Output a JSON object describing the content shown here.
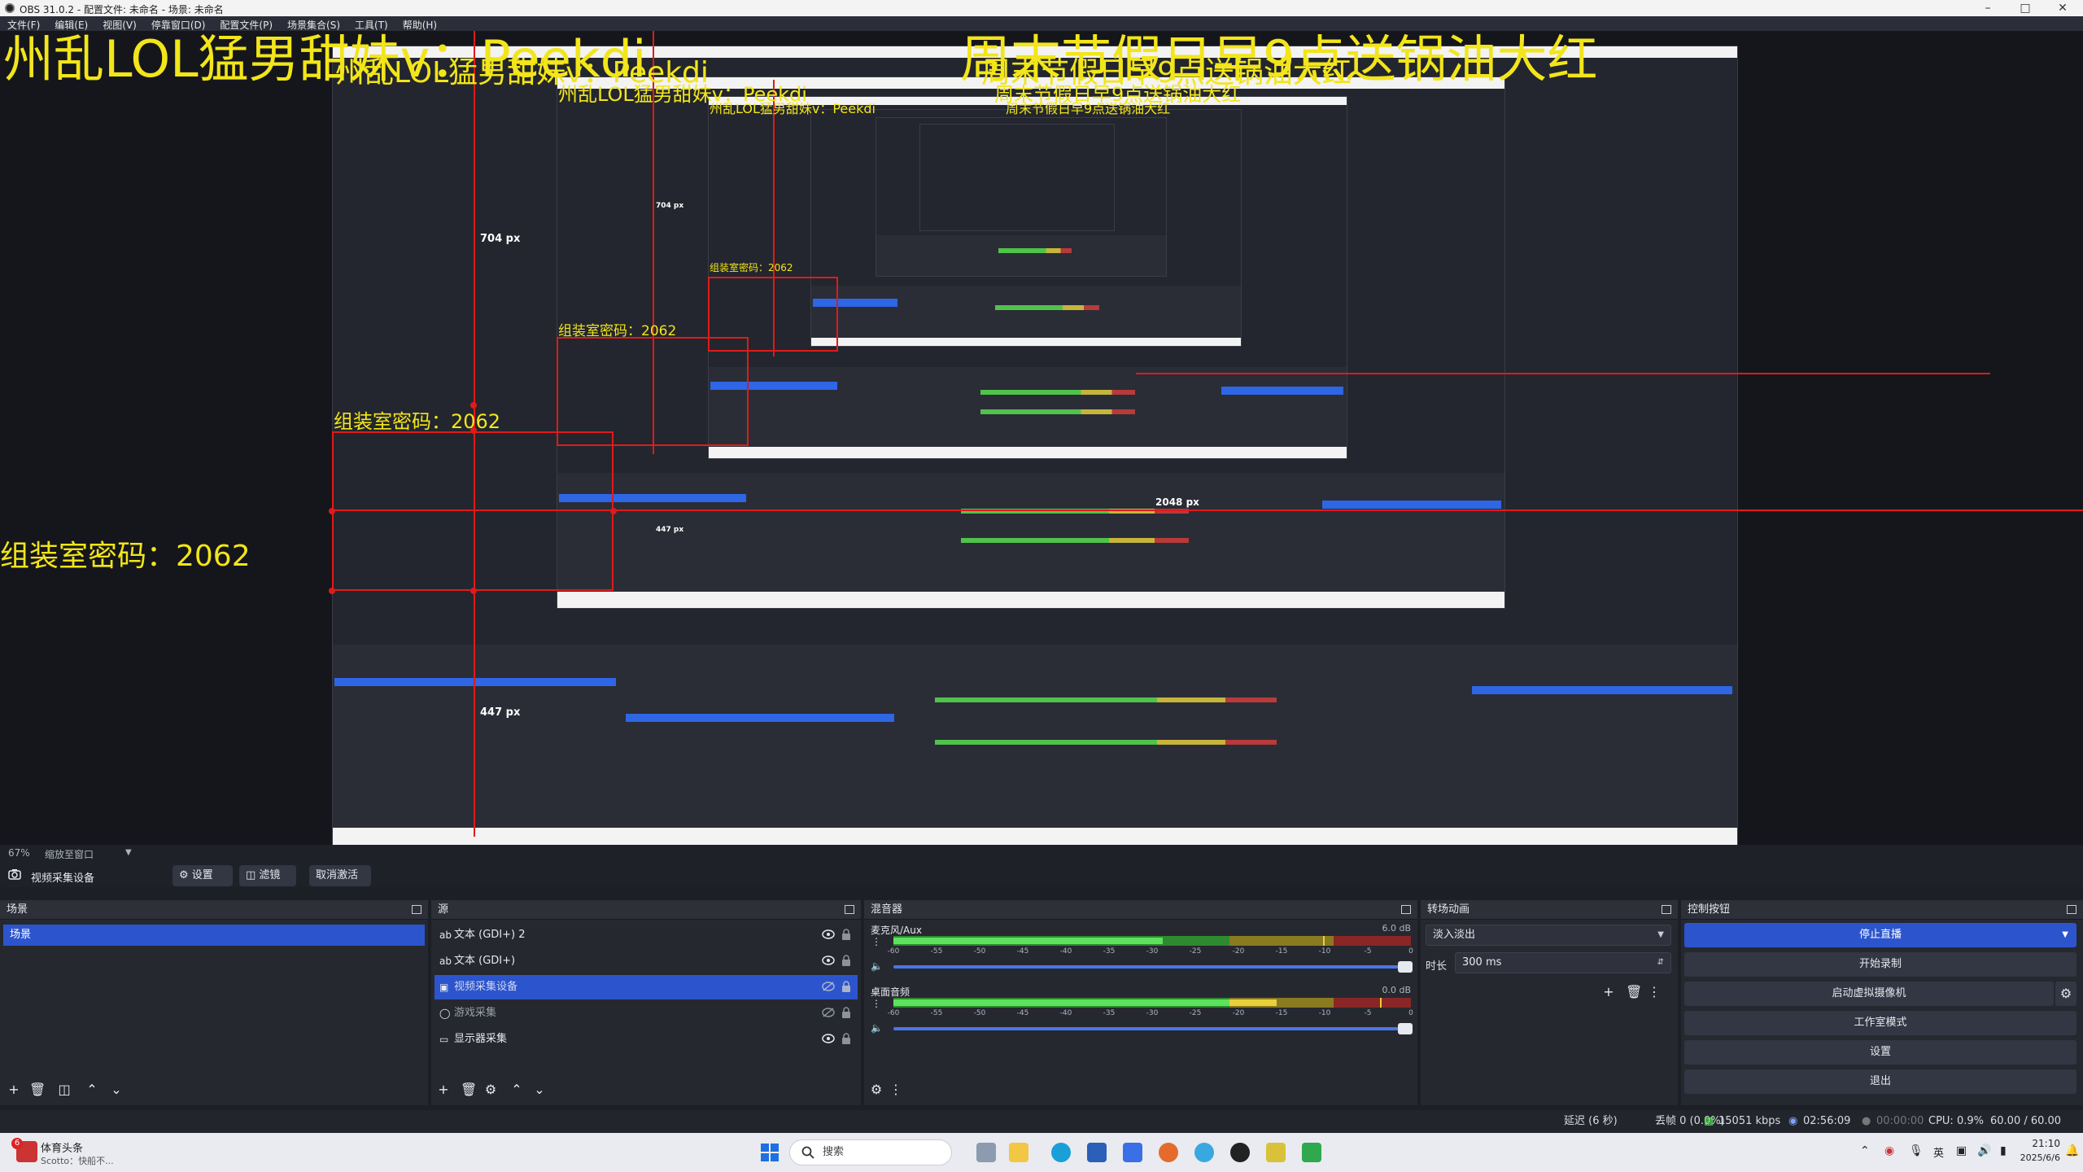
{
  "window": {
    "title": "OBS 31.0.2 - 配置文件: 未命名 - 场景: 未命名"
  },
  "menu": [
    "文件(F)",
    "编辑(E)",
    "视图(V)",
    "停靠窗口(D)",
    "配置文件(P)",
    "场景集合(S)",
    "工具(T)",
    "帮助(H)"
  ],
  "overlay": {
    "line_left": "州乱LOL猛男甜妹v：Peekdi",
    "line_right": "周末节假日早9点送锅油大红",
    "room_password": "组装室密码：2062"
  },
  "preview_measures": {
    "height_px": "704 px",
    "width_px": "447 px",
    "right_px": "2048 px"
  },
  "zoom": {
    "level": "67%",
    "mode": "缩放至窗口"
  },
  "source_toolbar": {
    "source_name": "视频采集设备",
    "settings_label": "设置",
    "filters_label": "滤镜",
    "deactivate_label": "取消激活"
  },
  "scenes": {
    "title": "场景",
    "items": [
      "场景"
    ]
  },
  "sources": {
    "title": "源",
    "items": [
      {
        "label": "文本 (GDI+) 2",
        "icon": "text-icon"
      },
      {
        "label": "文本 (GDI+)",
        "icon": "text-icon"
      },
      {
        "label": "视频采集设备",
        "icon": "camera-icon",
        "selected": true
      },
      {
        "label": "游戏采集",
        "icon": "gamepad-icon"
      },
      {
        "label": "显示器采集",
        "icon": "monitor-icon"
      }
    ]
  },
  "mixer": {
    "title": "混音器",
    "channels": [
      {
        "name": "麦克风/Aux",
        "db": "6.0 dB",
        "level": 0.52,
        "peak": 0.83
      },
      {
        "name": "桌面音频",
        "db": "0.0 dB",
        "level": 0.74,
        "peak": 0.94
      }
    ],
    "ticks": [
      "-60",
      "-55",
      "-50",
      "-45",
      "-40",
      "-35",
      "-30",
      "-25",
      "-20",
      "-15",
      "-10",
      "-5",
      "0"
    ]
  },
  "transitions": {
    "title": "转场动画",
    "selected": "淡入淡出",
    "duration_label": "时长",
    "duration": "300 ms"
  },
  "controls": {
    "title": "控制按钮",
    "stop_stream": "停止直播",
    "start_record": "开始录制",
    "start_virtualcam": "启动虚拟摄像机",
    "studio_mode": "工作室模式",
    "settings": "设置",
    "exit": "退出"
  },
  "status": {
    "delay": "延迟 (6 秒)",
    "dropped": "丢帧 0 (0.0%)",
    "bitrate": "15051 kbps",
    "stream_time": "02:56:09",
    "record_time": "00:00:00",
    "cpu": "CPU: 0.9%",
    "fps": "60.00 / 60.00 FPS"
  },
  "taskbar": {
    "notif_title": "体育头条",
    "notif_sub": "Scotto：快船不...",
    "notif_badge": "6",
    "search": "搜索",
    "ime": "英",
    "time": "21:10",
    "date": "2025/6/6"
  },
  "colors": {
    "accent": "#2c55cd",
    "overlay_text": "#f2e51a",
    "guide_red": "#e01a1a"
  }
}
